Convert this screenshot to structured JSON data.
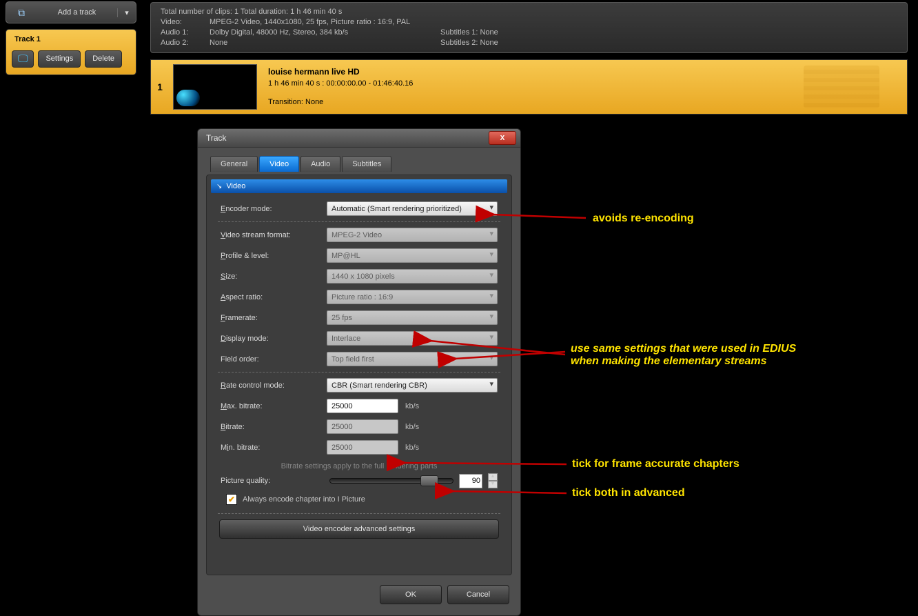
{
  "sidebar": {
    "add_track": "Add a track",
    "track_title": "Track 1",
    "settings": "Settings",
    "delete": "Delete"
  },
  "topinfo": {
    "line1": "Total number of clips: 1     Total duration: 1 h 46 min 40 s",
    "video_lab": "Video:",
    "video_val": "MPEG-2 Video,  1440x1080,  25  fps,  Picture ratio : 16:9,  PAL",
    "audio1_lab": "Audio 1:",
    "audio1_val": "Dolby Digital,  48000  Hz,  Stereo,  384  kb/s",
    "audio2_lab": "Audio 2:",
    "audio2_val": "None",
    "sub1": "Subtitles 1:  None",
    "sub2": "Subtitles 2:  None"
  },
  "clip": {
    "index": "1",
    "title": "louise hermann live HD",
    "time": "1 h 46 min 40 s :  00:00:00.00 - 01:46:40.16",
    "transition": "Transition: None"
  },
  "dialog": {
    "title": "Track",
    "tabs": {
      "general": "General",
      "video": "Video",
      "audio": "Audio",
      "subtitles": "Subtitles"
    },
    "section": "Video",
    "labels": {
      "encoder_mode": "Encoder mode:",
      "vsf": "Video stream format:",
      "profile": "Profile & level:",
      "size": "Size:",
      "aspect": "Aspect ratio:",
      "framerate": "Framerate:",
      "display": "Display mode:",
      "field": "Field order:",
      "rate_mode": "Rate control mode:",
      "max_bitrate": "Max. bitrate:",
      "bitrate": "Bitrate:",
      "min_bitrate": "Min. bitrate:",
      "note": "Bitrate settings apply to the full rendering parts",
      "picture_quality": "Picture quality:",
      "chapter_check": "Always encode chapter into I Picture",
      "adv": "Video encoder advanced settings"
    },
    "values": {
      "encoder_mode": "Automatic (Smart rendering prioritized)",
      "vsf": "MPEG-2 Video",
      "profile": "MP@HL",
      "size": "1440 x 1080 pixels",
      "aspect": "Picture ratio : 16:9",
      "framerate": "25  fps",
      "display": "Interlace",
      "field": "Top field first",
      "rate_mode": "CBR (Smart rendering CBR)",
      "max_bitrate": "25000",
      "bitrate": "25000",
      "min_bitrate": "25000",
      "unit": "kb/s",
      "quality": "90"
    },
    "ok": "OK",
    "cancel": "Cancel"
  },
  "annotations": {
    "a1": "avoids re-encoding",
    "a2a": "use same settings that were used in EDIUS",
    "a2b": "when making the elementary streams",
    "a3": "tick for frame accurate chapters",
    "a4": "tick both in advanced"
  }
}
